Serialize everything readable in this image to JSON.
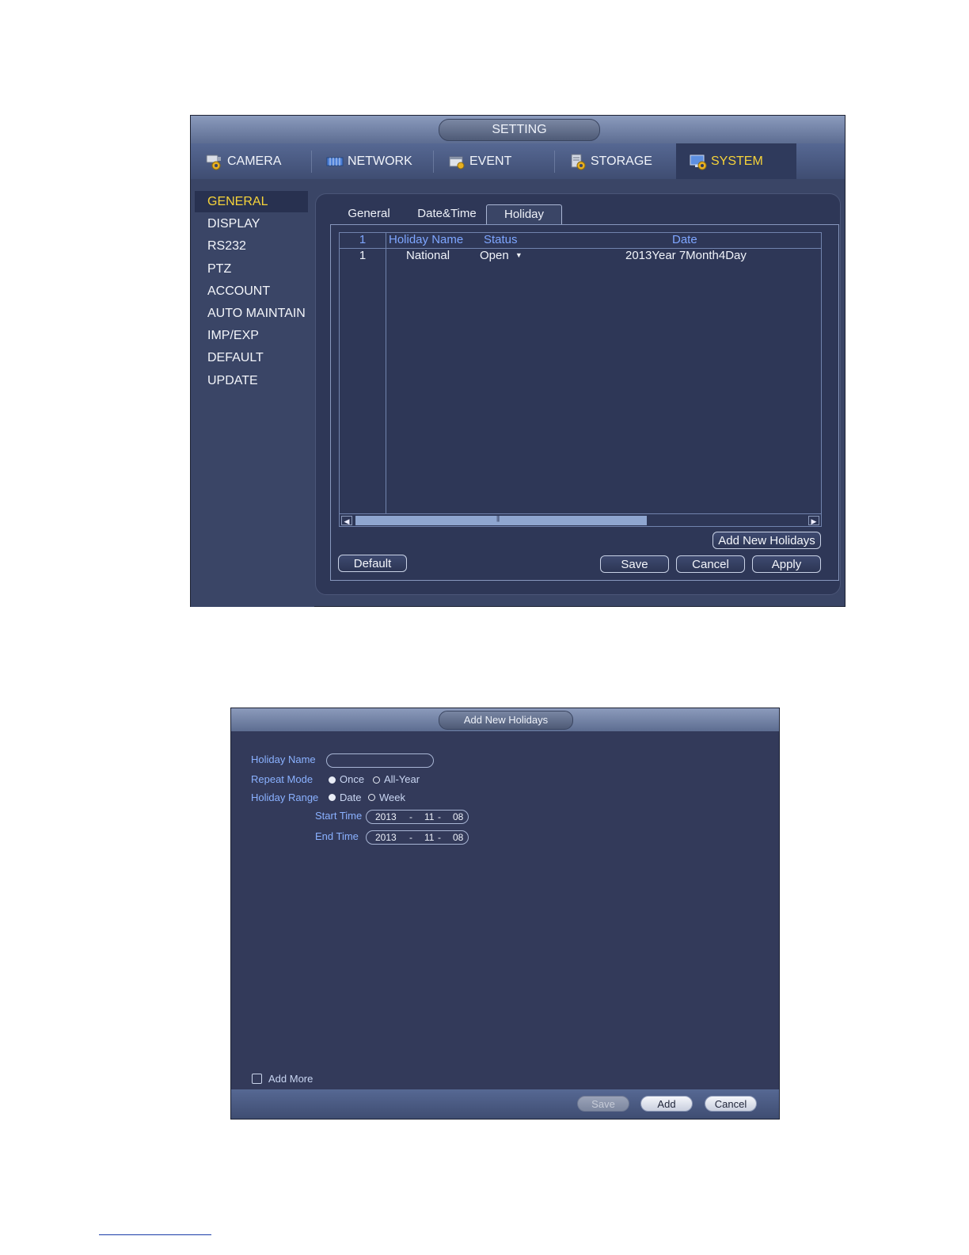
{
  "setting_window": {
    "title": "SETTING",
    "top_tabs": [
      {
        "label": "CAMERA",
        "icon": "camera-gear-icon"
      },
      {
        "label": "NETWORK",
        "icon": "network-icon"
      },
      {
        "label": "EVENT",
        "icon": "event-icon"
      },
      {
        "label": "STORAGE",
        "icon": "storage-gear-icon"
      },
      {
        "label": "SYSTEM",
        "icon": "system-gear-icon",
        "active": true
      }
    ],
    "sidebar": [
      "GENERAL",
      "DISPLAY",
      "RS232",
      "PTZ",
      "ACCOUNT",
      "AUTO MAINTAIN",
      "IMP/EXP",
      "DEFAULT",
      "UPDATE"
    ],
    "sidebar_active": "GENERAL",
    "sub_tabs": [
      "General",
      "Date&Time",
      "Holiday"
    ],
    "sub_tab_active": "Holiday",
    "table": {
      "headers": [
        "1",
        "Holiday Name",
        "Status",
        "Date"
      ],
      "rows": [
        {
          "index": "1",
          "name": "National",
          "status": "Open",
          "date": "2013Year 7Month4Day"
        }
      ]
    },
    "buttons": {
      "add_new": "Add New Holidays",
      "default": "Default",
      "save": "Save",
      "cancel": "Cancel",
      "apply": "Apply"
    },
    "colors": {
      "active_tab_text": "#f6d33a",
      "header_text": "#7ea6ff"
    }
  },
  "add_dialog": {
    "title": "Add New Holidays",
    "holiday_name_label": "Holiday Name",
    "holiday_name_value": "",
    "repeat_mode_label": "Repeat Mode",
    "repeat_options": [
      "Once",
      "All-Year"
    ],
    "repeat_selected": "Once",
    "holiday_range_label": "Holiday Range",
    "range_options": [
      "Date",
      "Week"
    ],
    "range_selected": "Date",
    "start_time_label": "Start Time",
    "start_time": {
      "year": "2013",
      "sep1": "-",
      "month": "11",
      "sep2": "-",
      "day": "08"
    },
    "end_time_label": "End Time",
    "end_time": {
      "year": "2013",
      "sep1": "-",
      "month": "11",
      "sep2": "-",
      "day": "08"
    },
    "add_more_label": "Add More",
    "add_more_checked": false,
    "buttons": {
      "save": "Save",
      "add": "Add",
      "cancel": "Cancel"
    }
  }
}
